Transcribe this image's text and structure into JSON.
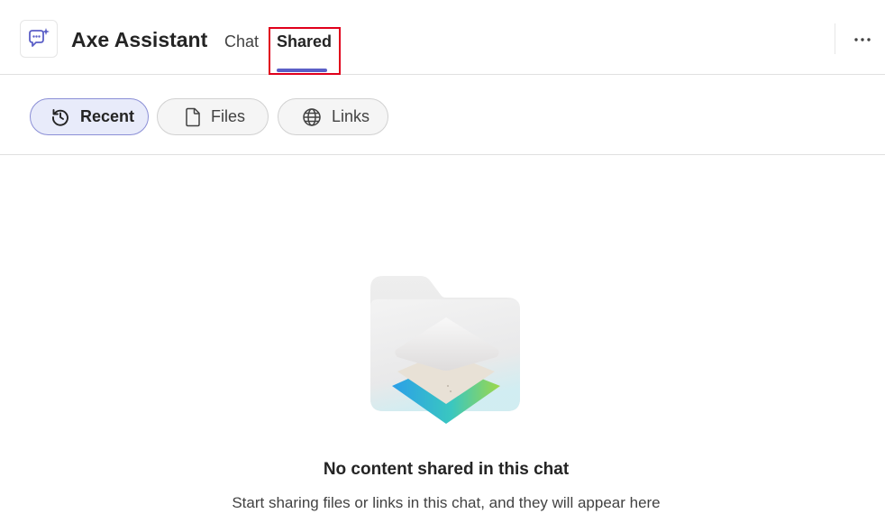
{
  "header": {
    "app_title": "Axe Assistant",
    "tabs": [
      {
        "label": "Chat",
        "selected": false
      },
      {
        "label": "Shared",
        "selected": true
      }
    ],
    "app_icon": "chat-sparkle-icon",
    "more_icon": "more-horizontal-icon"
  },
  "filters": [
    {
      "label": "Recent",
      "icon": "history-icon",
      "selected": true
    },
    {
      "label": "Files",
      "icon": "document-icon",
      "selected": false
    },
    {
      "label": "Links",
      "icon": "globe-icon",
      "selected": false
    }
  ],
  "empty_state": {
    "title": "No content shared in this chat",
    "subtitle": "Start sharing files or links in this chat, and they will appear here",
    "illustration": "shared-folder-illustration"
  },
  "colors": {
    "accent": "#5b5fc7",
    "highlight": "#e0001b",
    "selected_pill_bg": "#e8ebfa"
  }
}
